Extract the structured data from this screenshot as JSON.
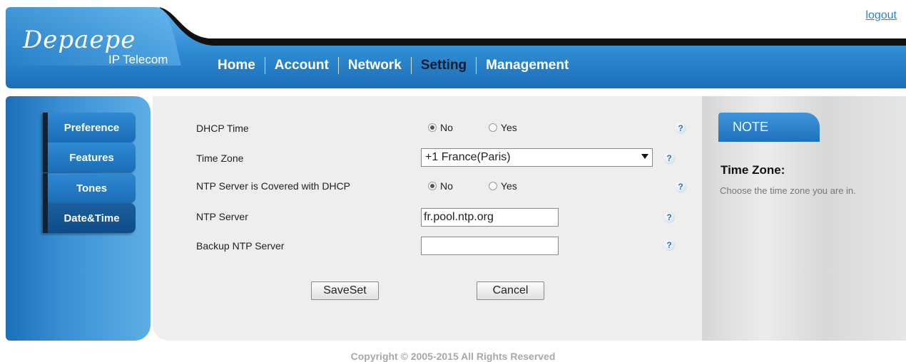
{
  "header": {
    "logo_text": "Depaepe",
    "logo_sub": "IP Telecom",
    "logout": "logout",
    "nav": [
      {
        "label": "Home"
      },
      {
        "label": "Account"
      },
      {
        "label": "Network"
      },
      {
        "label": "Setting",
        "active": true
      },
      {
        "label": "Management"
      }
    ]
  },
  "sidebar": {
    "items": [
      {
        "label": "Preference"
      },
      {
        "label": "Features"
      },
      {
        "label": "Tones"
      },
      {
        "label": "Date&Time",
        "active": true
      }
    ]
  },
  "form": {
    "dhcp_time": {
      "label": "DHCP Time",
      "options": [
        "No",
        "Yes"
      ],
      "selected": "No"
    },
    "time_zone": {
      "label": "Time Zone",
      "value": "+1 France(Paris)"
    },
    "ntp_dhcp": {
      "label": "NTP Server is Covered with DHCP",
      "options": [
        "No",
        "Yes"
      ],
      "selected": "No"
    },
    "ntp_server": {
      "label": "NTP Server",
      "value": "fr.pool.ntp.org"
    },
    "backup_ntp": {
      "label": "Backup NTP Server",
      "value": ""
    },
    "save_label": "SaveSet",
    "cancel_label": "Cancel",
    "help_glyph": "?"
  },
  "note": {
    "tab": "NOTE",
    "title": "Time Zone:",
    "text": "Choose the time zone you are in."
  },
  "footer": {
    "copyright": "Copyright © 2005-2015 All Rights Reserved"
  },
  "colors": {
    "brand_blue": "#2f8ad2",
    "nav_active": "#0c1c2c",
    "link": "#2f7fd3"
  },
  "icons": {
    "help": "question-help-icon",
    "dropdown": "chevron-down-icon"
  }
}
